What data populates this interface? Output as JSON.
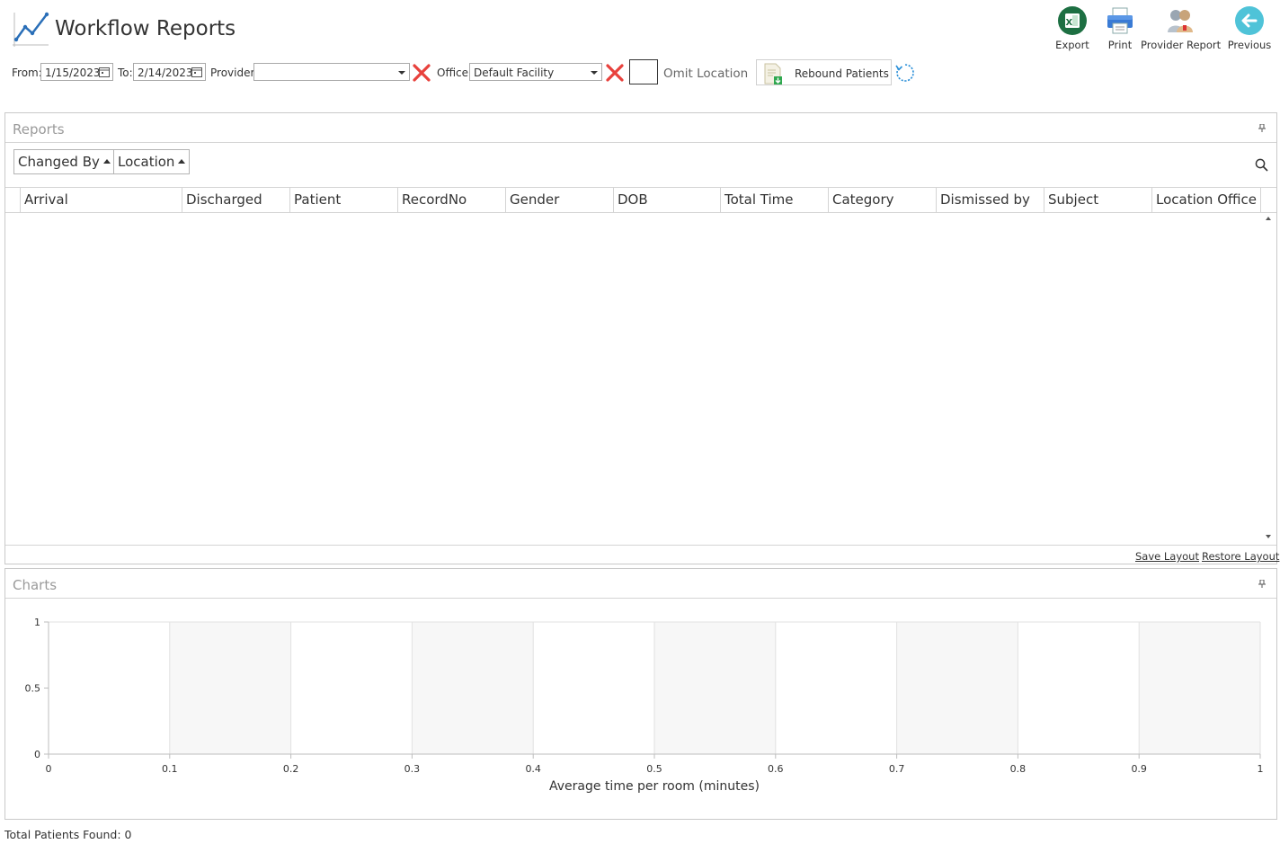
{
  "header": {
    "title": "Workflow Reports",
    "toolbar": [
      {
        "id": "export",
        "label": "Export",
        "icon": "excel-icon"
      },
      {
        "id": "print",
        "label": "Print",
        "icon": "printer-icon"
      },
      {
        "id": "provider_report",
        "label": "Provider Report",
        "icon": "provider-report-icon"
      },
      {
        "id": "previous",
        "label": "Previous",
        "icon": "arrow-left-icon"
      }
    ]
  },
  "filters": {
    "from_label": "From:",
    "from_value": "1/15/2023",
    "to_label": "To:",
    "to_value": "2/14/2023",
    "provider_label": "Provider:",
    "provider_value": "",
    "office_label": "Office:",
    "office_value": "Default Facility",
    "omit_location_label": "Omit Location",
    "omit_location_checked": false,
    "rebound_label": "Rebound Patients"
  },
  "reports": {
    "title": "Reports",
    "group_by": [
      "Changed By",
      "Location"
    ],
    "columns": [
      "Arrival",
      "Discharged",
      "Patient",
      "RecordNo",
      "Gender",
      "DOB",
      "Total Time",
      "Category",
      "Dismissed by",
      "Subject",
      "Location Office"
    ],
    "rows": [],
    "save_layout": "Save Layout",
    "restore_layout": "Restore Layout"
  },
  "charts": {
    "title": "Charts"
  },
  "chart_data": {
    "type": "bar",
    "title": "",
    "xlabel": "Average time per room (minutes)",
    "ylabel": "",
    "xlim": [
      0,
      1
    ],
    "ylim": [
      0,
      1
    ],
    "x_ticks": [
      "0",
      "0.1",
      "0.2",
      "0.3",
      "0.4",
      "0.5",
      "0.6",
      "0.7",
      "0.8",
      "0.9",
      "1"
    ],
    "y_ticks": [
      "0",
      "0.5",
      "1"
    ],
    "series": [],
    "grid": true,
    "band_color": "#f7f7f7"
  },
  "status": {
    "total_patients": "Total Patients Found: 0"
  },
  "colors": {
    "accent": "#2a8fd8",
    "clear_x": "#e8413c",
    "excel_green": "#1d6f42",
    "previous_teal": "#4fc3d8"
  }
}
